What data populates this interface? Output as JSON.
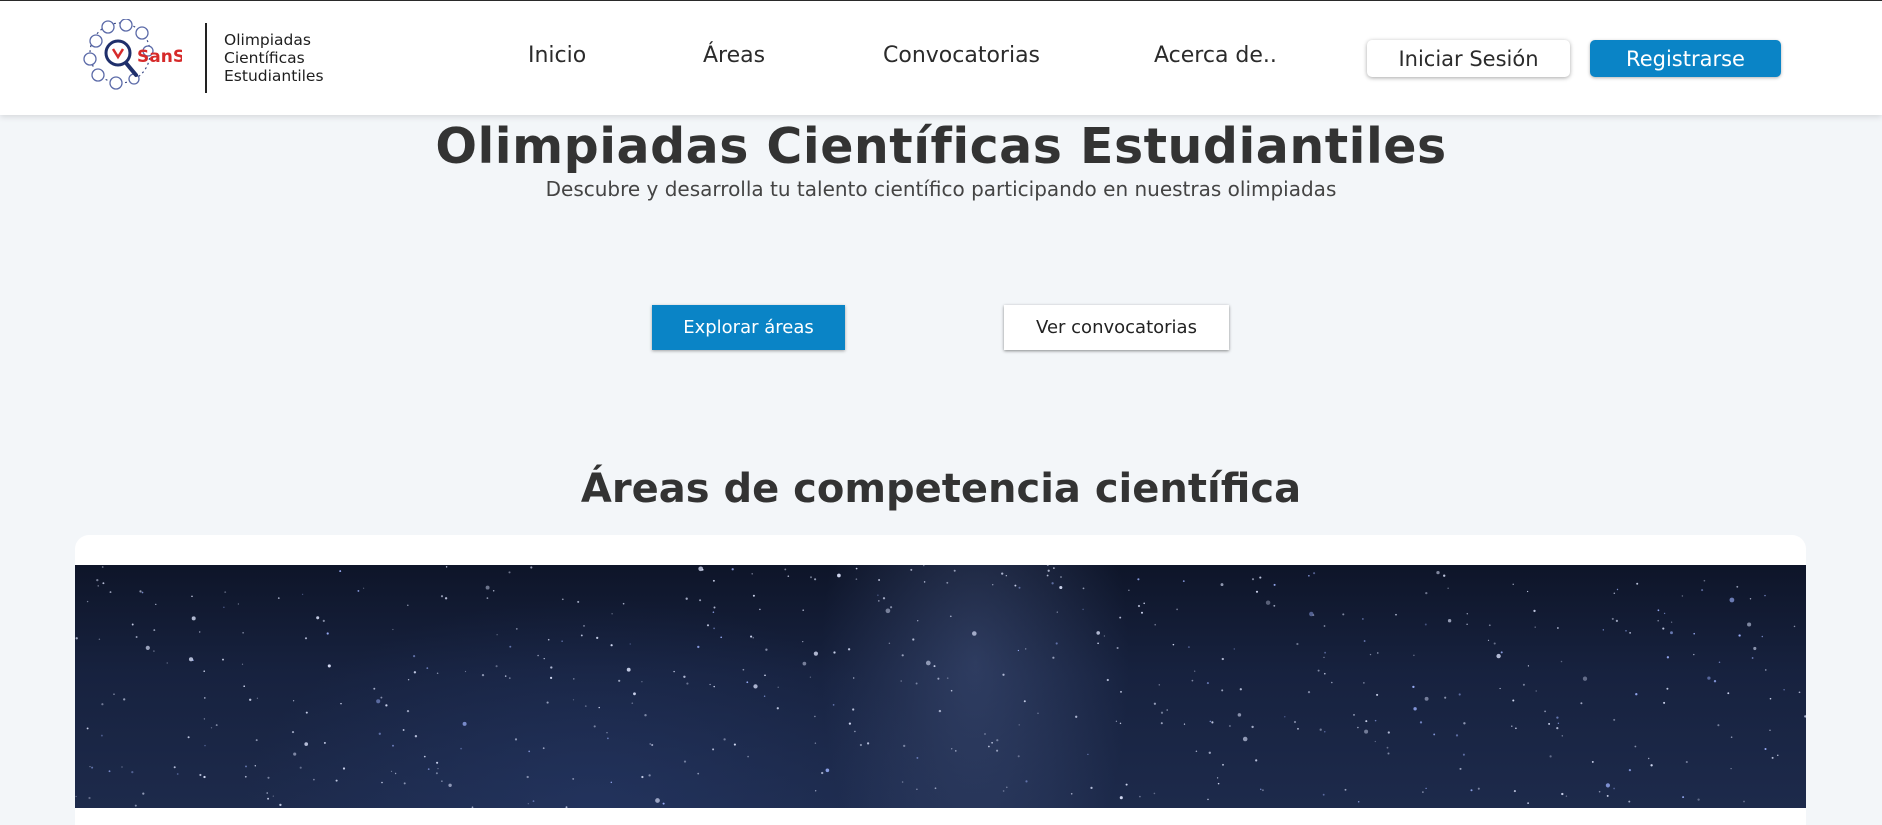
{
  "brand": {
    "logo_text": "SanSi",
    "name_lines": [
      "Olimpiadas",
      "Científicas",
      "Estudiantiles"
    ]
  },
  "nav": {
    "links": [
      "Inicio",
      "Áreas",
      "Convocatorias",
      "Acerca de.."
    ],
    "login_label": "Iniciar Sesión",
    "register_label": "Registrarse"
  },
  "hero": {
    "title": "Olimpiadas Científicas Estudiantiles",
    "subtitle": "Descubre y desarrolla tu talento científico participando en nuestras olimpiadas",
    "primary_button": "Explorar áreas",
    "secondary_button": "Ver convocatorias"
  },
  "areas": {
    "section_title": "Áreas de competencia científica",
    "image": "starry-night-sky"
  },
  "colors": {
    "accent": "#0a84c6",
    "background": "#f3f6f9",
    "logo_red": "#d62a2a",
    "logo_navy": "#1f2f6b"
  }
}
